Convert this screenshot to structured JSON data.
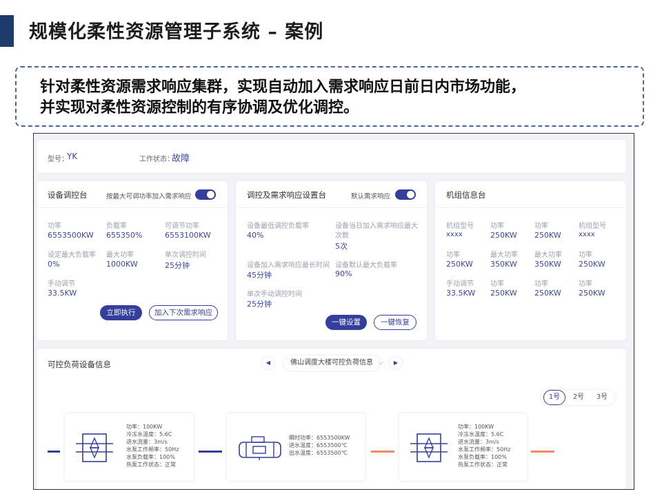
{
  "slide": {
    "title": "规模化柔性资源管理子系统 – 案例",
    "description_line1": "针对柔性资源需求响应集群，实现自动加入需求响应日前日内市场功能，",
    "description_line2": "并实现对柔性资源控制的有序协调及优化调控。"
  },
  "header": {
    "model_label": "型号：",
    "model_value": "YK",
    "status_label": "工作状态：",
    "status_value": "故障"
  },
  "device_panel": {
    "title": "设备调控台",
    "toggle_label": "按最大可调功率加入需求响应",
    "toggle_on": true,
    "fields": [
      {
        "label": "功率",
        "value": "6553500KW"
      },
      {
        "label": "负载率",
        "value": "655350%"
      },
      {
        "label": "可调节功率",
        "value": "6553100KW"
      },
      {
        "label": "设定最大负载率",
        "value": "0%"
      },
      {
        "label": "最大功率",
        "value": "1000KW"
      },
      {
        "label": "单次调控时间",
        "value": "25分钟"
      },
      {
        "label": "手动调节",
        "value": "33.5KW"
      }
    ],
    "execute_button": "立即执行",
    "next_button": "加入下次需求响应"
  },
  "response_panel": {
    "title": "调控及需求响应设置台",
    "toggle_label": "默认需求响应",
    "toggle_on": true,
    "fields": [
      {
        "label": "设备最低调控负载率",
        "value": "40%"
      },
      {
        "label_line1": "设备当日加入需求响应最大",
        "label_line2": "次数",
        "value": "5次"
      },
      {
        "label": "设备加入需求响应最长时间",
        "value": "45分钟"
      },
      {
        "label": "设备默认最大负载率",
        "value": "90%"
      },
      {
        "label": "单次手动调控时间",
        "value": "25分钟"
      }
    ],
    "set_button": "一键设置",
    "restore_button": "一键恢复"
  },
  "unit_panel": {
    "title": "机组信息台",
    "rows": [
      [
        {
          "label": "机组型号",
          "value": "xxxx"
        },
        {
          "label": "功率",
          "value": "250KW"
        },
        {
          "label": "功率",
          "value": "250KW"
        },
        {
          "label": "机组型号",
          "value": "xxxx"
        }
      ],
      [
        {
          "label": "功率",
          "value": "250KW"
        },
        {
          "label": "最大功率",
          "value": "350KW"
        },
        {
          "label": "最大功率",
          "value": "350KW"
        },
        {
          "label": "功率",
          "value": "250KW"
        }
      ],
      [
        {
          "label": "手动调节",
          "value": "33.5KW"
        },
        {
          "label": "功率",
          "value": "250KW"
        },
        {
          "label": "功率",
          "value": "250KW"
        },
        {
          "label": "功率",
          "value": "250KW"
        }
      ]
    ]
  },
  "load_panel": {
    "title": "可控负荷设备信息",
    "prev_icon": "caret-left-icon",
    "next_icon": "caret-right-icon",
    "dropdown_value": "佛山调度大楼可控负荷信息",
    "tabs": [
      "1号",
      "2号",
      "3号"
    ],
    "active_tab": 0,
    "devices": [
      {
        "icon": "cooling-tower-icon",
        "lines": [
          "功率：100KW",
          "冷冻水温度：5.6C",
          "进水流量：3m/s",
          "水泵工作频率：50Hz",
          "水泵负载率：100%",
          "热泵工作状态：正常"
        ]
      },
      {
        "icon": "chiller-icon",
        "lines": [
          "瞬时功率：6553500KW",
          "进水温度：6553500℃",
          "出水温度：6553500℃"
        ]
      },
      {
        "icon": "cooling-tower-icon",
        "lines": [
          "功率：100KW",
          "冷冻水温度：5.6C",
          "进水流量：3m/s",
          "水泵工作频率：50Hz",
          "水泵负载率：100%",
          "热泵工作状态：正常"
        ]
      }
    ],
    "pipe_colors": {
      "supply": "#343e9c",
      "return": "#f08a5d"
    }
  },
  "colors": {
    "accent": "#343e9c",
    "title_bar": "#1f3b6e",
    "fault": "#3a46a8"
  }
}
